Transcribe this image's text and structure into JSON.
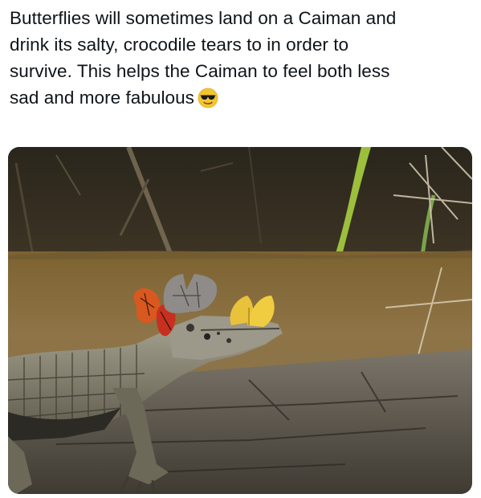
{
  "post": {
    "caption_lines": [
      "Butterflies will sometimes land on a Caiman and",
      "drink its salty, crocodile tears to in order to",
      "survive. This helps the Caiman to feel both less",
      "sad and more fabulous"
    ],
    "emoji_icon": "sunglasses-face-emoji",
    "photo": {
      "subject": "caiman-on-log-with-butterflies",
      "colors": {
        "water": "#8a6f3e",
        "bank": "#2e2a1f",
        "log": "#5d574c",
        "caiman": "#8a8574",
        "butterfly_orange": "#d9581f",
        "butterfly_yellow": "#e8c23a",
        "butterfly_gray": "#8e8b88"
      }
    }
  }
}
